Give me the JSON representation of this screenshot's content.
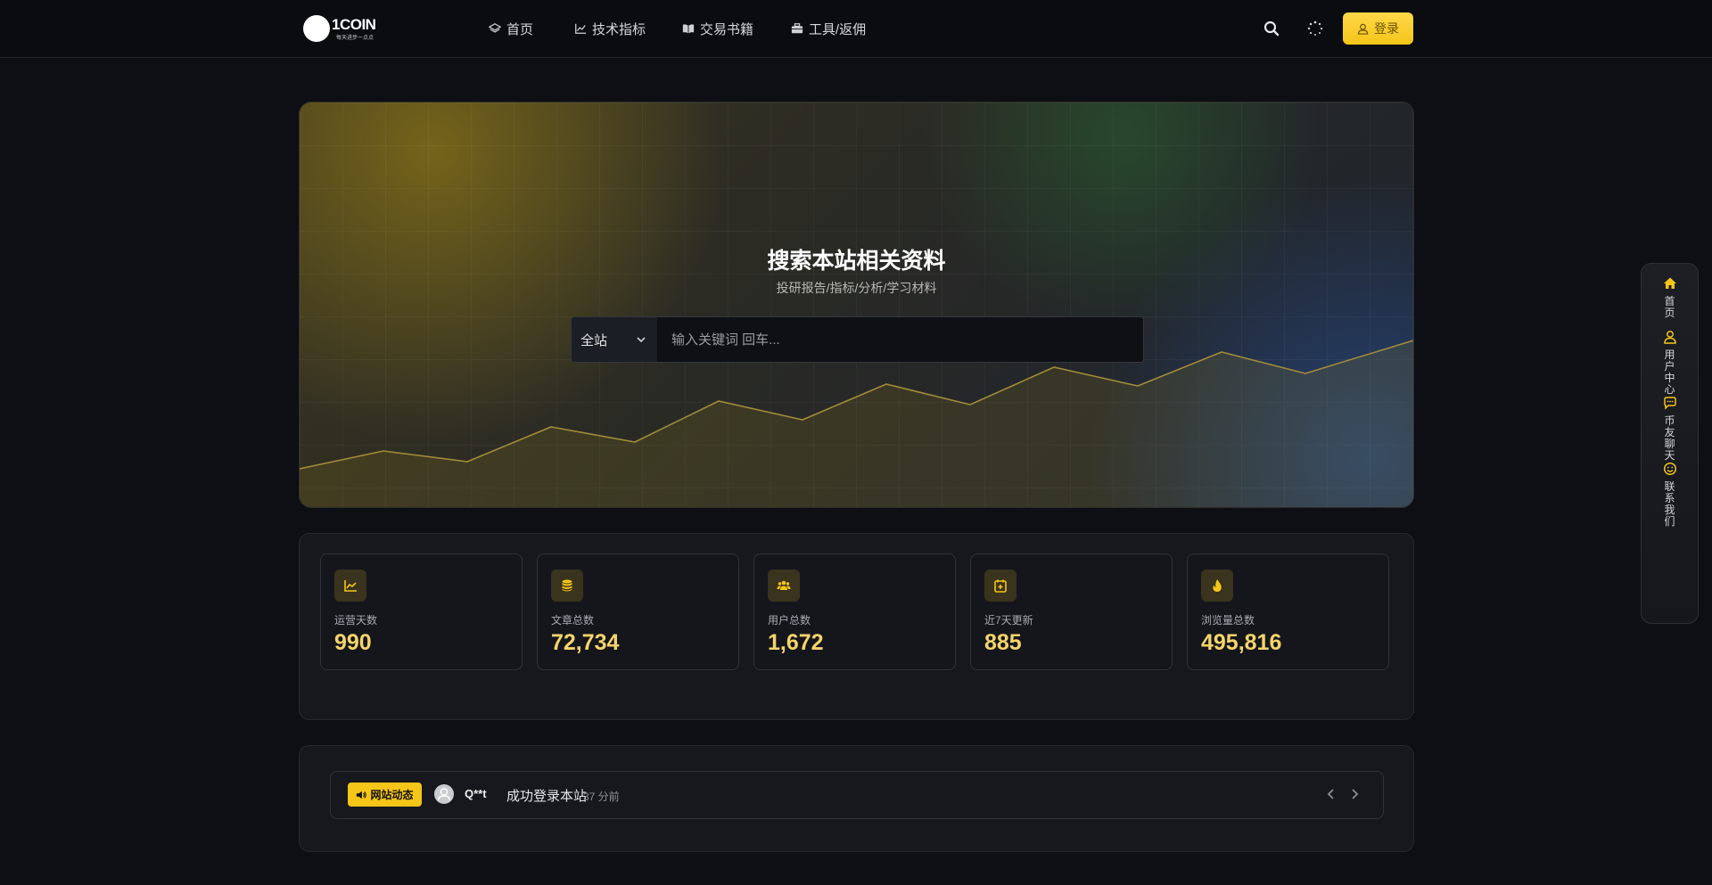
{
  "brand": {
    "name": "1COIN",
    "tagline": "每天进步一点点"
  },
  "nav": {
    "items": [
      {
        "label": "首页",
        "icon": "layers-icon"
      },
      {
        "label": "技术指标",
        "icon": "chart-line-icon"
      },
      {
        "label": "交易书籍",
        "icon": "book-icon"
      },
      {
        "label": "工具/返佣",
        "icon": "toolbox-icon"
      }
    ],
    "login_label": "登录"
  },
  "hero": {
    "title": "搜索本站相关资料",
    "subtitle": "投研报告/指标/分析/学习材料",
    "select_value": "全站",
    "search_placeholder": "输入关键词 回车..."
  },
  "stats": [
    {
      "label": "运营天数",
      "value": "990",
      "icon": "chart-area-icon"
    },
    {
      "label": "文章总数",
      "value": "72,734",
      "icon": "database-icon"
    },
    {
      "label": "用户总数",
      "value": "1,672",
      "icon": "users-icon"
    },
    {
      "label": "近7天更新",
      "value": "885",
      "icon": "calendar-plus-icon"
    },
    {
      "label": "浏览量总数",
      "value": "495,816",
      "icon": "fire-icon"
    }
  ],
  "activity": {
    "badge": "网站动态",
    "user": "Q**t",
    "action": "成功登录本站",
    "time": "37 分前"
  },
  "side_rail": [
    {
      "label": "首页",
      "icon": "home-icon"
    },
    {
      "label": "用户中心",
      "icon": "user-icon"
    },
    {
      "label": "币友聊天",
      "icon": "chat-icon"
    },
    {
      "label": "联系我们",
      "icon": "smile-icon"
    }
  ],
  "colors": {
    "accent": "#f5c518",
    "stat_value": "#f5d46a",
    "background": "#0d0f14"
  }
}
